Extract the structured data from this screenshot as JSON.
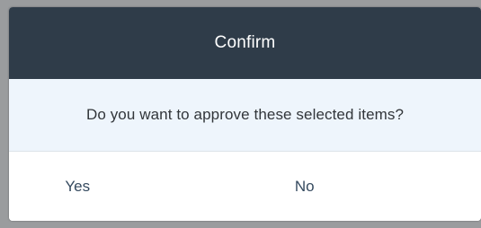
{
  "dialog": {
    "title": "Confirm",
    "message": "Do you want to approve these selected items?",
    "buttons": {
      "yes_label": "Yes",
      "no_label": "No"
    }
  },
  "colors": {
    "header_bg": "#2f3c49",
    "message_bg": "#eef5fc",
    "button_text": "#354a5f"
  }
}
